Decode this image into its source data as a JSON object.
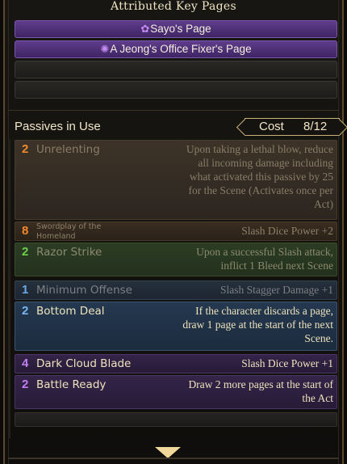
{
  "key_pages": {
    "title": "Attributed Key Pages",
    "slots": [
      {
        "icon": "flower-emblem-icon",
        "name": "Sayo's Page"
      },
      {
        "icon": "gear-emblem-icon",
        "name": "A Jeong's Office Fixer's Page"
      },
      {
        "name": ""
      },
      {
        "name": ""
      }
    ]
  },
  "passives": {
    "header": "Passives in Use",
    "cost_label": "Cost",
    "cost_value": "8/12",
    "items": [
      {
        "cost": "2",
        "name": "Unrelenting",
        "desc_lines": [
          "Upon taking a lethal blow, reduce",
          "all incoming damage including",
          "what activated this passive by 25",
          "for the Scene (Activates once per",
          "Act)"
        ],
        "color": "#f08a2a"
      },
      {
        "cost": "8",
        "name": "Swordplay of the Homeland",
        "desc_lines": [
          "Slash Dice Power +2"
        ],
        "color": "#f48a2c"
      },
      {
        "cost": "2",
        "name": "Razor Strike",
        "desc_lines": [
          "Upon a successful Slash attack,",
          "inflict 1 Bleed next Scene"
        ],
        "color": "#6bd04a"
      },
      {
        "cost": "1",
        "name": "Minimum Offense",
        "desc_lines": [
          "Slash Stagger Damage +1"
        ],
        "color": "#6aa8e8"
      },
      {
        "cost": "2",
        "name": "Bottom Deal",
        "desc_lines": [
          "If the character discards a page,",
          "draw 1 page at the start of the next",
          "Scene."
        ],
        "color": "#7ab6f4"
      },
      {
        "cost": "4",
        "name": "Dark Cloud Blade",
        "desc_lines": [
          "Slash Dice Power +1"
        ],
        "color": "#c27ef2"
      },
      {
        "cost": "2",
        "name": "Battle Ready",
        "desc_lines": [
          "Draw 2 more pages at the start of",
          "the Act"
        ],
        "color": "#c27ef2"
      }
    ]
  },
  "icons": {
    "scroll_down": "down-triangle-icon"
  }
}
